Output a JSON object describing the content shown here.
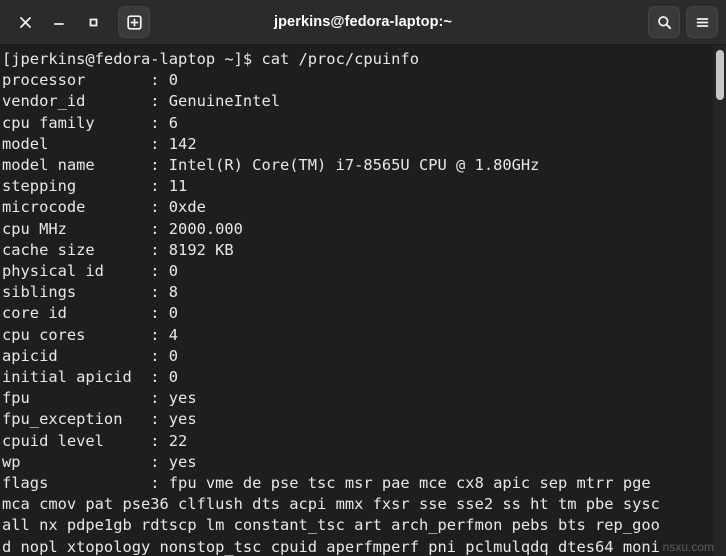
{
  "window": {
    "title": "jperkins@fedora-laptop:~",
    "titlebar_bg": "#2b2b2b",
    "terminal_bg": "#1e1e1e",
    "text_color": "#e8e8e8"
  },
  "titlebar": {
    "close_label": "×",
    "minimize_label": "−",
    "maximize_label": "□",
    "new_tab_label": "+",
    "search_label": "Search",
    "menu_label": "Menu"
  },
  "terminal": {
    "prompt": "[jperkins@fedora-laptop ~]$ ",
    "command": "cat /proc/cpuinfo",
    "lines": [
      "[jperkins@fedora-laptop ~]$ cat /proc/cpuinfo",
      "processor       : 0",
      "vendor_id       : GenuineIntel",
      "cpu family      : 6",
      "model           : 142",
      "model name      : Intel(R) Core(TM) i7-8565U CPU @ 1.80GHz",
      "stepping        : 11",
      "microcode       : 0xde",
      "cpu MHz         : 2000.000",
      "cache size      : 8192 KB",
      "physical id     : 0",
      "siblings        : 8",
      "core id         : 0",
      "cpu cores       : 4",
      "apicid          : 0",
      "initial apicid  : 0",
      "fpu             : yes",
      "fpu_exception   : yes",
      "cpuid level     : 22",
      "wp              : yes",
      "flags           : fpu vme de pse tsc msr pae mce cx8 apic sep mtrr pge",
      "mca cmov pat pse36 clflush dts acpi mmx fxsr sse sse2 ss ht tm pbe sysc",
      "all nx pdpe1gb rdtscp lm constant_tsc art arch_perfmon pebs bts rep_goo",
      "d nopl xtopology nonstop_tsc cpuid aperfmperf pni pclmulqdq dtes64 moni"
    ],
    "fields": [
      {
        "key": "processor",
        "value": "0"
      },
      {
        "key": "vendor_id",
        "value": "GenuineIntel"
      },
      {
        "key": "cpu family",
        "value": "6"
      },
      {
        "key": "model",
        "value": "142"
      },
      {
        "key": "model name",
        "value": "Intel(R) Core(TM) i7-8565U CPU @ 1.80GHz"
      },
      {
        "key": "stepping",
        "value": "11"
      },
      {
        "key": "microcode",
        "value": "0xde"
      },
      {
        "key": "cpu MHz",
        "value": "2000.000"
      },
      {
        "key": "cache size",
        "value": "8192 KB"
      },
      {
        "key": "physical id",
        "value": "0"
      },
      {
        "key": "siblings",
        "value": "8"
      },
      {
        "key": "core id",
        "value": "0"
      },
      {
        "key": "cpu cores",
        "value": "4"
      },
      {
        "key": "apicid",
        "value": "0"
      },
      {
        "key": "initial apicid",
        "value": "0"
      },
      {
        "key": "fpu",
        "value": "yes"
      },
      {
        "key": "fpu_exception",
        "value": "yes"
      },
      {
        "key": "cpuid level",
        "value": "22"
      },
      {
        "key": "wp",
        "value": "yes"
      },
      {
        "key": "flags",
        "value": "fpu vme de pse tsc msr pae mce cx8 apic sep mtrr pge mca cmov pat pse36 clflush dts acpi mmx fxsr sse sse2 ss ht tm pbe syscall nx pdpe1gb rdtscp lm constant_tsc art arch_perfmon pebs bts rep_good nopl xtopology nonstop_tsc cpuid aperfmperf pni pclmulqdq dtes64 moni"
      }
    ]
  },
  "watermark": {
    "text": "nsxu.com"
  }
}
